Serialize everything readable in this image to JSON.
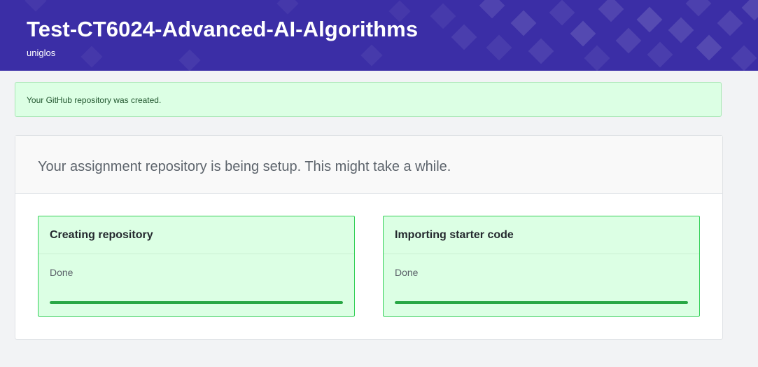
{
  "header": {
    "title": "Test-CT6024-Advanced-AI-Algorithms",
    "subtitle": "uniglos",
    "background_color": "#3b2ea6"
  },
  "flash": {
    "message": "Your GitHub repository was created.",
    "background_color": "#dcffe4"
  },
  "panel": {
    "heading": "Your assignment repository is being setup. This might take a while.",
    "cards": [
      {
        "title": "Creating repository",
        "status": "Done",
        "progress_percent": 100
      },
      {
        "title": "Importing starter code",
        "status": "Done",
        "progress_percent": 100
      }
    ]
  },
  "colors": {
    "success_fill": "#28a745",
    "success_border": "#34d058",
    "success_background": "#dcffe4"
  }
}
